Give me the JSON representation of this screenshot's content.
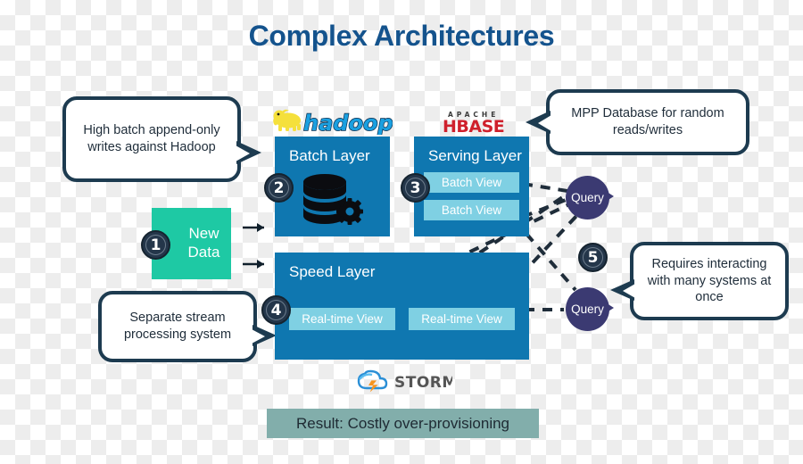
{
  "title": "Complex Architectures",
  "colors": {
    "title": "#14538d",
    "bubble_border": "#1d3b50",
    "layer_blue": "#0f77b0",
    "view_chip": "#7fd0e3",
    "new_data_teal": "#1ec9a4",
    "query_purple": "#3b3a72",
    "badge_navy": "#24364a",
    "result_banner": "#82aeab",
    "hadoop_yellow": "#f5e03c",
    "hbase_red": "#cf202c",
    "storm_orange": "#f7941e",
    "dashed_line": "#1f2d3a"
  },
  "callouts": [
    {
      "id": "batch-writes",
      "text": "High batch append-only writes against Hadoop",
      "tail": "right"
    },
    {
      "id": "mpp-database",
      "text": "MPP Database for random reads/writes",
      "tail": "left"
    },
    {
      "id": "separate-stream",
      "text": "Separate stream processing system",
      "tail": "right"
    },
    {
      "id": "requires-interacting",
      "text": "Requires interacting with many systems at once",
      "tail": "left"
    }
  ],
  "new_data": {
    "line1": "New",
    "line2": "Data",
    "badge": "1"
  },
  "layers": {
    "batch": {
      "title": "Batch Layer",
      "badge": "2",
      "logo": {
        "name": "hadoop-logo",
        "wordmark": "hadoop"
      },
      "icon": "database-gear-icon"
    },
    "serving": {
      "title": "Serving Layer",
      "badge": "3",
      "logo": {
        "name": "hbase-logo",
        "top_word": "APACHE",
        "wordmark": "HBASE"
      },
      "views": [
        "Batch View",
        "Batch View"
      ]
    },
    "speed": {
      "title": "Speed Layer",
      "badge": "4",
      "logo": {
        "name": "storm-logo",
        "wordmark": "STORM"
      },
      "views": [
        "Real-time View",
        "Real-time View"
      ]
    }
  },
  "queries": [
    {
      "label": "Query",
      "position": "top"
    },
    {
      "label": "Query",
      "position": "bottom"
    }
  ],
  "standalone_badge": {
    "number": "5"
  },
  "result_banner": {
    "text": "Result: Costly over-provisioning"
  },
  "arrows": [
    {
      "from": "new-data",
      "to": "batch-layer"
    },
    {
      "from": "new-data",
      "to": "speed-layer"
    }
  ],
  "connectors": [
    {
      "from": "batch-view-1",
      "to": "query-top",
      "style": "dashed"
    },
    {
      "from": "batch-view-2",
      "to": "query-top",
      "style": "dashed"
    },
    {
      "from": "serving-layer",
      "to": "query-bottom",
      "style": "dashed"
    },
    {
      "from": "real-time-view-1",
      "to": "query-top",
      "style": "dashed"
    },
    {
      "from": "real-time-view-2",
      "to": "query-top",
      "style": "dashed"
    },
    {
      "from": "real-time-view-2",
      "to": "query-bottom",
      "style": "dashed"
    }
  ]
}
